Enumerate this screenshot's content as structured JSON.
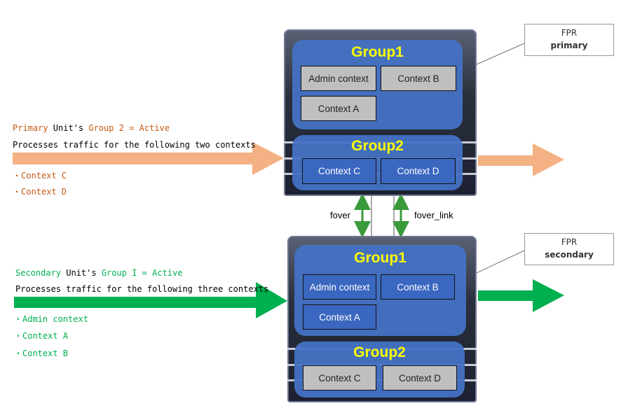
{
  "primary_unit": {
    "label": "FPR",
    "role": "primary",
    "group1": {
      "title": "Group1",
      "state": "standby",
      "contexts": [
        "Admin context",
        "Context B",
        "Context A"
      ]
    },
    "group2": {
      "title": "Group2",
      "state": "active",
      "contexts": [
        "Context C",
        "Context D"
      ]
    }
  },
  "secondary_unit": {
    "label": "FPR",
    "role": "secondary",
    "group1": {
      "title": "Group1",
      "state": "active",
      "contexts": [
        "Admin context",
        "Context B",
        "Context A"
      ]
    },
    "group2": {
      "title": "Group2",
      "state": "standby",
      "contexts": [
        "Context C",
        "Context D"
      ]
    }
  },
  "links": {
    "fover": "fover",
    "fover_link": "fover_link"
  },
  "primary_note": {
    "unit": "Primary",
    "unit_suffix": " Unit's ",
    "group": "Group 2 = Active",
    "desc": "Processes traffic for the following two contexts",
    "items": [
      "・Context C",
      "・Context D"
    ]
  },
  "secondary_note": {
    "unit": "Secondary",
    "unit_suffix": " Unit's ",
    "group": "Group I = Active",
    "desc": "Processes traffic for the following three contexts",
    "items": [
      "・Admin context",
      "・Context A",
      "・Context B"
    ]
  },
  "colors": {
    "primary_traffic": "#f4b183",
    "secondary_traffic": "#00b050",
    "group_fill": "#4472c4",
    "group_title": "#ffff00",
    "link_arrow": "#3a9a3a"
  }
}
